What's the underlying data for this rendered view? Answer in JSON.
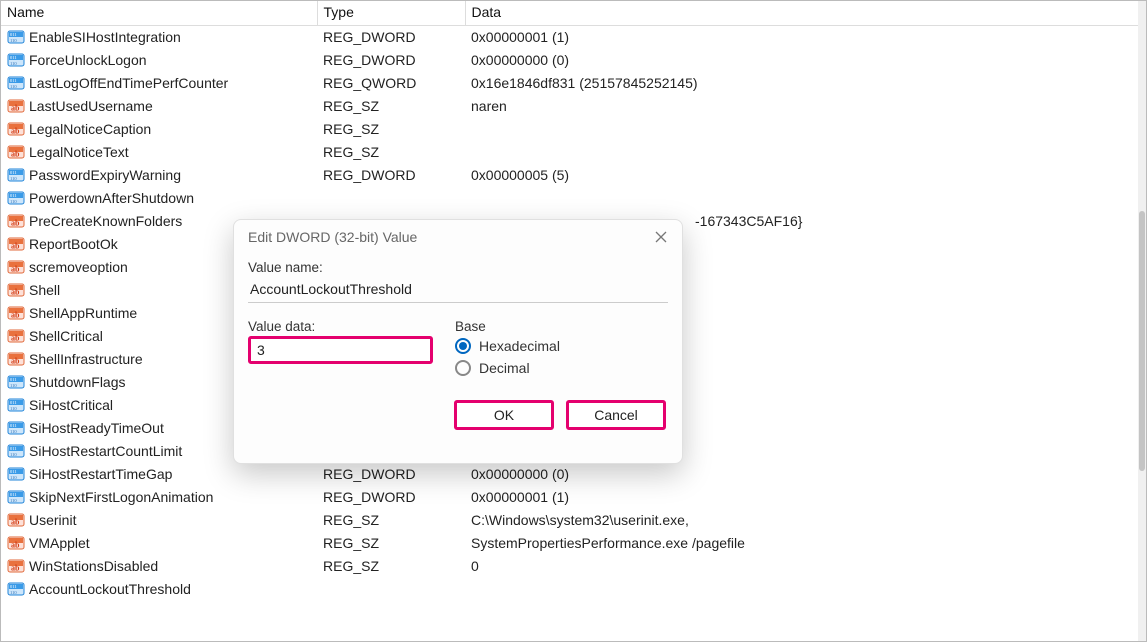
{
  "columns": {
    "name": "Name",
    "type": "Type",
    "data": "Data"
  },
  "icon_dword": "dword-icon",
  "icon_sz": "string-icon",
  "rows": [
    {
      "icon": "dword",
      "name": "EnableSIHostIntegration",
      "type": "REG_DWORD",
      "data": "0x00000001 (1)"
    },
    {
      "icon": "dword",
      "name": "ForceUnlockLogon",
      "type": "REG_DWORD",
      "data": "0x00000000 (0)"
    },
    {
      "icon": "dword",
      "name": "LastLogOffEndTimePerfCounter",
      "type": "REG_QWORD",
      "data": "0x16e1846df831 (25157845252145)"
    },
    {
      "icon": "sz",
      "name": "LastUsedUsername",
      "type": "REG_SZ",
      "data": "naren"
    },
    {
      "icon": "sz",
      "name": "LegalNoticeCaption",
      "type": "REG_SZ",
      "data": ""
    },
    {
      "icon": "sz",
      "name": "LegalNoticeText",
      "type": "REG_SZ",
      "data": ""
    },
    {
      "icon": "dword",
      "name": "PasswordExpiryWarning",
      "type": "REG_DWORD",
      "data": "0x00000005 (5)"
    },
    {
      "icon": "dword",
      "name": "PowerdownAfterShutdown",
      "type": "",
      "data": ""
    },
    {
      "icon": "sz",
      "name": "PreCreateKnownFolders",
      "type": "",
      "data": "-167343C5AF16}"
    },
    {
      "icon": "sz",
      "name": "ReportBootOk",
      "type": "",
      "data": ""
    },
    {
      "icon": "sz",
      "name": "scremoveoption",
      "type": "",
      "data": ""
    },
    {
      "icon": "sz",
      "name": "Shell",
      "type": "",
      "data": ""
    },
    {
      "icon": "sz",
      "name": "ShellAppRuntime",
      "type": "",
      "data": ""
    },
    {
      "icon": "sz",
      "name": "ShellCritical",
      "type": "",
      "data": ""
    },
    {
      "icon": "sz",
      "name": "ShellInfrastructure",
      "type": "",
      "data": ""
    },
    {
      "icon": "dword",
      "name": "ShutdownFlags",
      "type": "",
      "data": ""
    },
    {
      "icon": "dword",
      "name": "SiHostCritical",
      "type": "",
      "data": ""
    },
    {
      "icon": "dword",
      "name": "SiHostReadyTimeOut",
      "type": "REG_DWORD",
      "data": "0x00000000 (0)"
    },
    {
      "icon": "dword",
      "name": "SiHostRestartCountLimit",
      "type": "REG_DWORD",
      "data": "0x00000000 (0)"
    },
    {
      "icon": "dword",
      "name": "SiHostRestartTimeGap",
      "type": "REG_DWORD",
      "data": "0x00000000 (0)"
    },
    {
      "icon": "dword",
      "name": "SkipNextFirstLogonAnimation",
      "type": "REG_DWORD",
      "data": "0x00000001 (1)"
    },
    {
      "icon": "sz",
      "name": "Userinit",
      "type": "REG_SZ",
      "data": "C:\\Windows\\system32\\userinit.exe,"
    },
    {
      "icon": "sz",
      "name": "VMApplet",
      "type": "REG_SZ",
      "data": "SystemPropertiesPerformance.exe /pagefile"
    },
    {
      "icon": "sz",
      "name": "WinStationsDisabled",
      "type": "REG_SZ",
      "data": "0"
    },
    {
      "icon": "dword",
      "name": "AccountLockoutThreshold",
      "type": "",
      "data": ""
    }
  ],
  "dialog": {
    "title": "Edit DWORD (32-bit) Value",
    "value_name_label": "Value name:",
    "value_name": "AccountLockoutThreshold",
    "value_data_label": "Value data:",
    "value_data": "3",
    "base_label": "Base",
    "base_hex": "Hexadecimal",
    "base_dec": "Decimal",
    "base_selected": "hex",
    "ok": "OK",
    "cancel": "Cancel"
  },
  "highlight_color": "#e4006e"
}
